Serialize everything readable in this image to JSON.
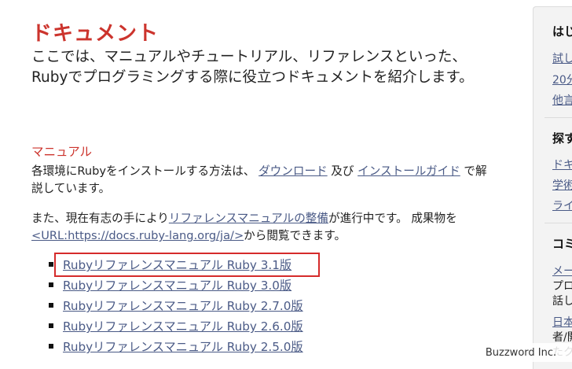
{
  "page": {
    "title": "ドキュメント",
    "lead": "ここでは、マニュアルやチュートリアル、リファレンスといった、 Rubyでプログラミングする際に役立つドキュメントを紹介します。"
  },
  "manual": {
    "heading": "マニュアル",
    "p1_prefix": "各環境にRubyをインストールする方法は、 ",
    "p1_link_download": "ダウンロード",
    "p1_middle": " 及び ",
    "p1_link_install": "インストールガイド",
    "p1_suffix": " で解説しています。",
    "p2_prefix": "また、現在有志の手により",
    "p2_link_ref": "リファレンスマニュアルの整備",
    "p2_middle": "が進行中です。 成果物を",
    "p2_link_url": "<URL:https://docs.ruby-lang.org/ja/>",
    "p2_suffix": "から閲覧できます。"
  },
  "reference_links": [
    {
      "label": "Rubyリファレンスマニュアル Ruby 3.1版"
    },
    {
      "label": "Rubyリファレンスマニュアル Ruby 3.0版"
    },
    {
      "label": "Rubyリファレンスマニュアル Ruby 2.7.0版"
    },
    {
      "label": "Rubyリファレンスマニュアル Ruby 2.6.0版"
    },
    {
      "label": "Rubyリファレンスマニュアル Ruby 2.5.0版"
    }
  ],
  "sidebar": {
    "heading1": "はじ",
    "links1": [
      "試し",
      "20分",
      "他言"
    ],
    "heading2": "探す",
    "links2": [
      "ドキ",
      "学術",
      "ライ"
    ],
    "heading3": "コミ",
    "link3a": "メー",
    "text3a": [
      "プロ",
      "話し"
    ],
    "link3b": "日本",
    "text3b": [
      "者/開",
      "たク"
    ]
  },
  "watermark": "Buzzword Inc.",
  "colors": {
    "accent": "#cc342d",
    "link": "#4a5a86",
    "highlight_box": "#d52b2b"
  }
}
